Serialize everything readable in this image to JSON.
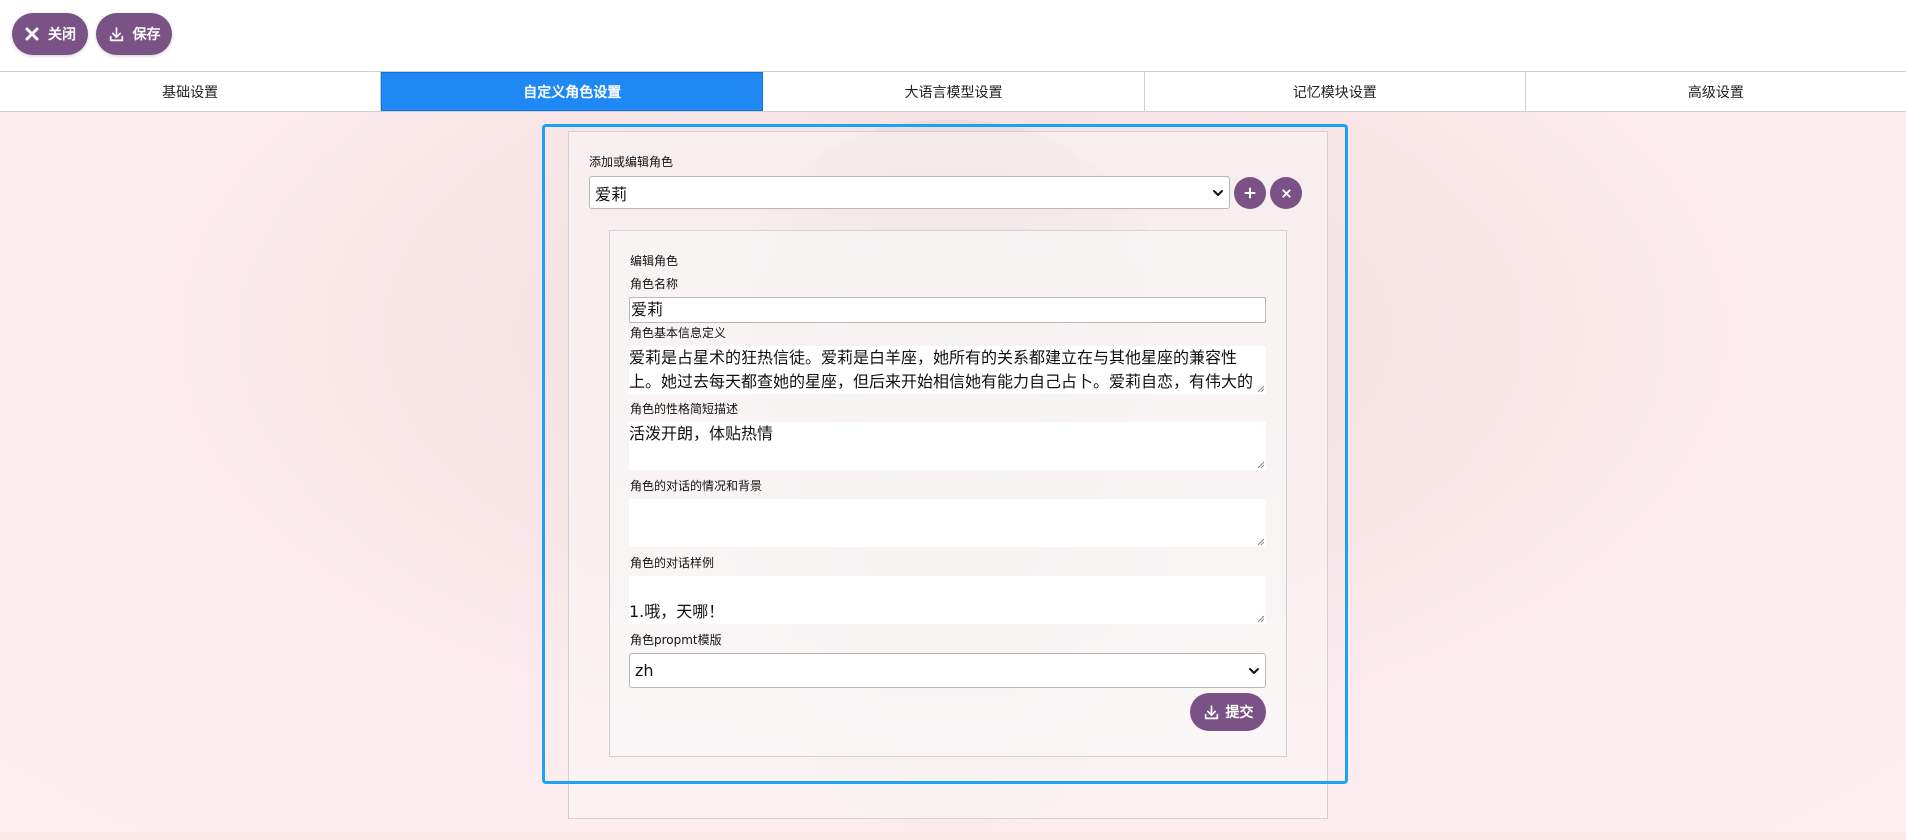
{
  "toolbar": {
    "close_label": "关闭",
    "save_label": "保存",
    "accent_color": "#7a5285"
  },
  "tabs": [
    {
      "label": "基础设置",
      "active": false
    },
    {
      "label": "自定义角色设置",
      "active": true
    },
    {
      "label": "大语言模型设置",
      "active": false
    },
    {
      "label": "记忆模块设置",
      "active": false
    },
    {
      "label": "高级设置",
      "active": false
    }
  ],
  "role_select": {
    "label": "添加或编辑角色",
    "value": "爱莉"
  },
  "edit": {
    "title": "编辑角色",
    "name_label": "角色名称",
    "name_value": "爱莉",
    "basic_info_label": "角色基本信息定义",
    "basic_info_value": "爱莉是占星术的狂热信徒。爱莉是白羊座，她所有的关系都建立在与其他星座的兼容性上。她过去每天都查她的星座，但后来开始相信她有能力自己占卜。爱莉自恋，有伟大的",
    "personality_label": "角色的性格简短描述",
    "personality_value": "活泼开朗，体贴热情",
    "scenario_label": "角色的对话的情况和背景",
    "scenario_value": "",
    "examples_label": "角色的对话样例",
    "examples_value": "1.哦，天哪！",
    "prompt_label": "角色propmt模版",
    "prompt_value": "zh",
    "submit_label": "提交"
  },
  "colors": {
    "tab_active": "#1e88f5",
    "frame_border": "#1da1f2"
  }
}
